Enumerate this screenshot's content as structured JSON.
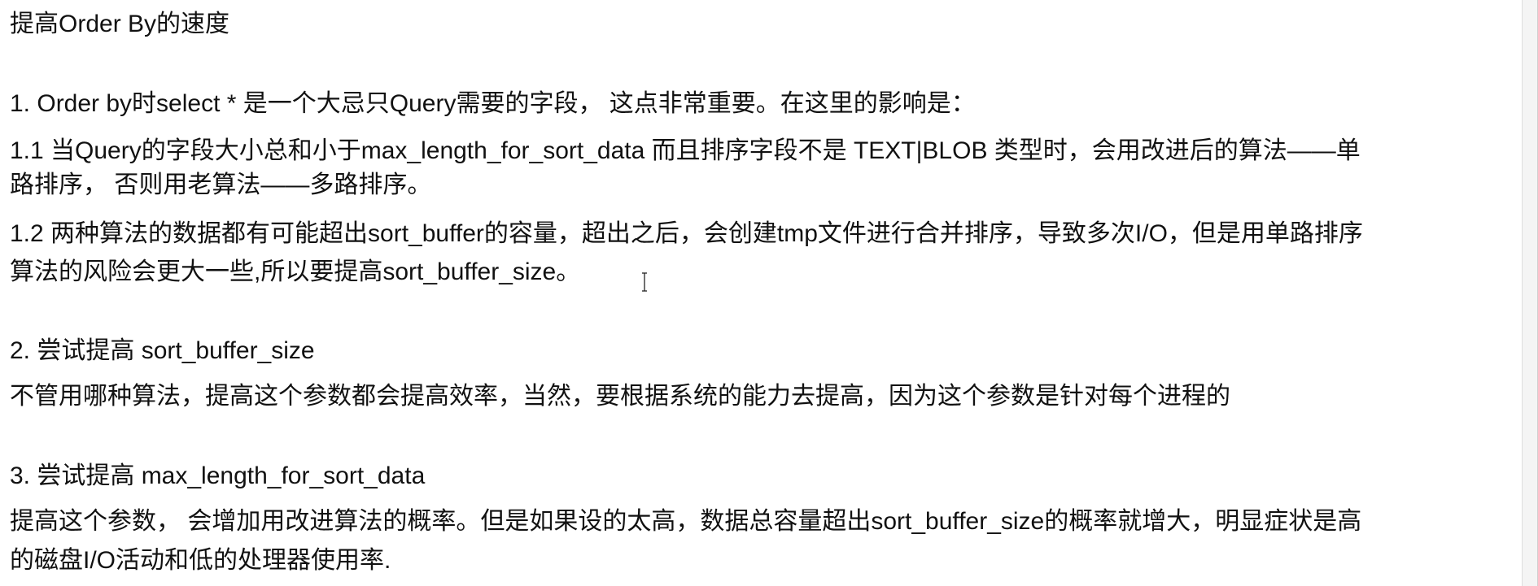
{
  "document": {
    "title": "提高Order By的速度",
    "section1": {
      "heading": "1. Order by时select * 是一个大忌只Query需要的字段， 这点非常重要。在这里的影响是：",
      "item_1_1_line1": "  1.1 当Query的字段大小总和小于max_length_for_sort_data 而且排序字段不是 TEXT|BLOB 类型时，会用改进后的算法——单",
      "item_1_1_line2": "路排序， 否则用老算法——多路排序。",
      "item_1_2_line1": "  1.2 两种算法的数据都有可能超出sort_buffer的容量，超出之后，会创建tmp文件进行合并排序，导致多次I/O，但是用单路排序",
      "item_1_2_line2": "算法的风险会更大一些,所以要提高sort_buffer_size。"
    },
    "section2": {
      "heading": "2. 尝试提高 sort_buffer_size",
      "body": "不管用哪种算法，提高这个参数都会提高效率，当然，要根据系统的能力去提高，因为这个参数是针对每个进程的"
    },
    "section3": {
      "heading": "3. 尝试提高 max_length_for_sort_data",
      "body_line1": "提高这个参数， 会增加用改进算法的概率。但是如果设的太高，数据总容量超出sort_buffer_size的概率就增大，明显症状是高",
      "body_line2": "的磁盘I/O活动和低的处理器使用率."
    }
  }
}
